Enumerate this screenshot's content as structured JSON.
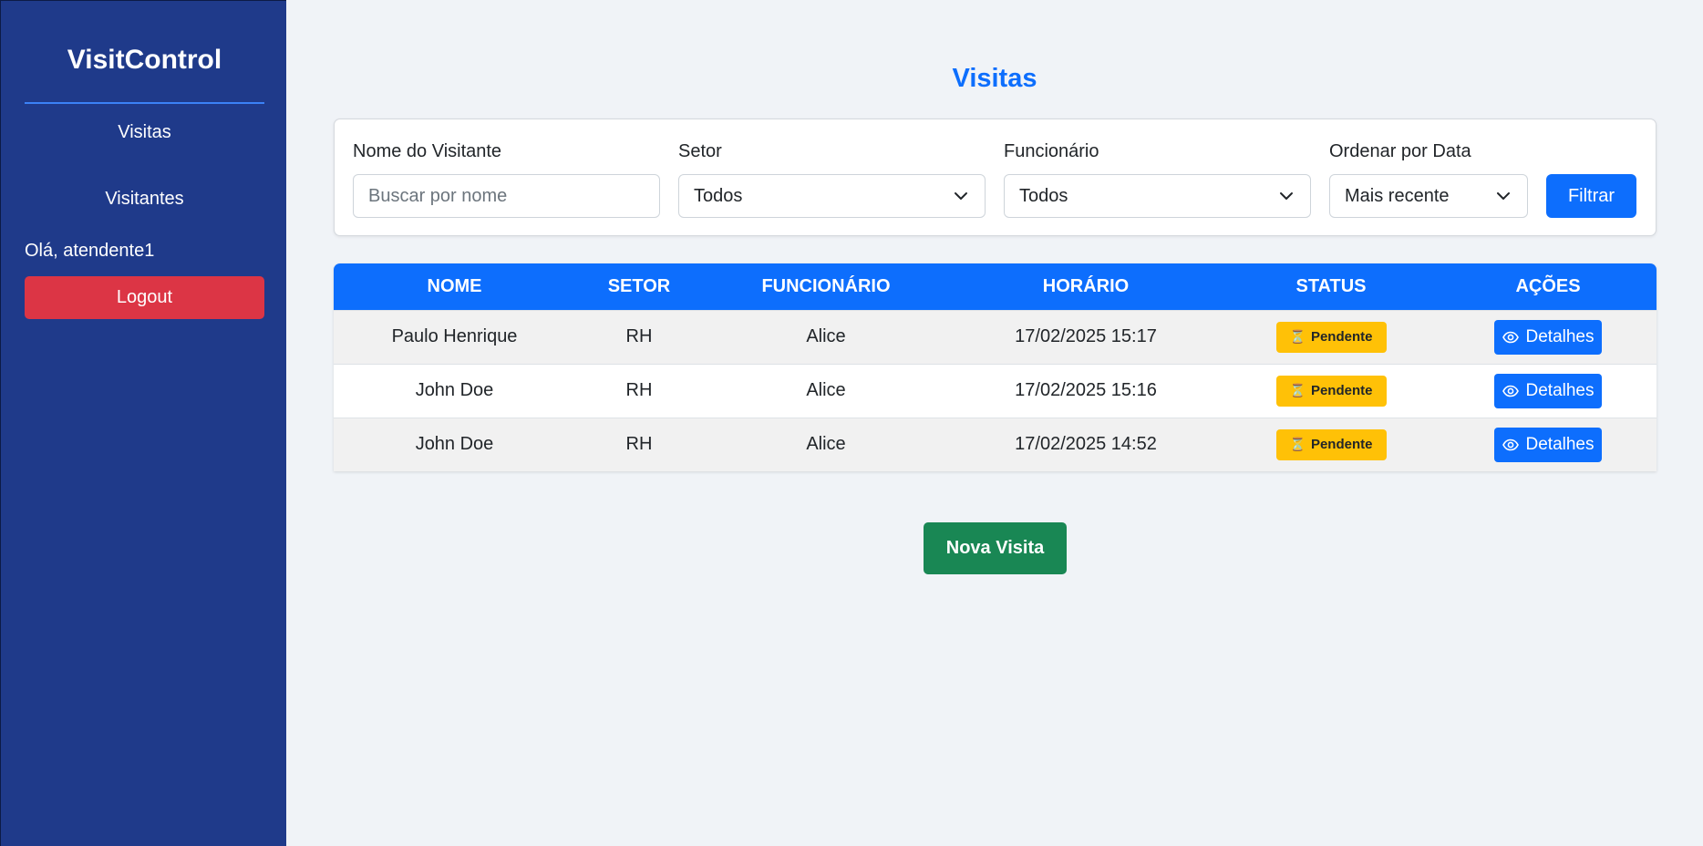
{
  "sidebar": {
    "brand": "VisitControl",
    "nav": {
      "visitas": "Visitas",
      "visitantes": "Visitantes"
    },
    "greeting": "Olá, atendente1",
    "logout_label": "Logout",
    "colors": {
      "background": "#1f3a8a",
      "logout": "#dc3545"
    }
  },
  "main": {
    "title": "Visitas",
    "filters": {
      "name_label": "Nome do Visitante",
      "name_placeholder": "Buscar por nome",
      "name_value": "",
      "setor_label": "Setor",
      "setor_value": "Todos",
      "funcionario_label": "Funcionário",
      "funcionario_value": "Todos",
      "order_label": "Ordenar por Data",
      "order_value": "Mais recente",
      "filter_button": "Filtrar"
    },
    "table": {
      "headers": [
        "NOME",
        "SETOR",
        "FUNCIONÁRIO",
        "HORÁRIO",
        "STATUS",
        "AÇÕES"
      ],
      "rows": [
        {
          "nome": "Paulo Henrique",
          "setor": "RH",
          "funcionario": "Alice",
          "horario": "17/02/2025 15:17",
          "status": "Pendente",
          "acao": "Detalhes"
        },
        {
          "nome": "John Doe",
          "setor": "RH",
          "funcionario": "Alice",
          "horario": "17/02/2025 15:16",
          "status": "Pendente",
          "acao": "Detalhes"
        },
        {
          "nome": "John Doe",
          "setor": "RH",
          "funcionario": "Alice",
          "horario": "17/02/2025 14:52",
          "status": "Pendente",
          "acao": "Detalhes"
        }
      ]
    },
    "new_visit_button": "Nova Visita",
    "colors": {
      "primary": "#0d6efd",
      "success": "#198754",
      "warning": "#ffc107"
    },
    "icons": {
      "status": "hourglass-icon",
      "details": "eye-icon",
      "select": "chevron-down-icon"
    }
  }
}
